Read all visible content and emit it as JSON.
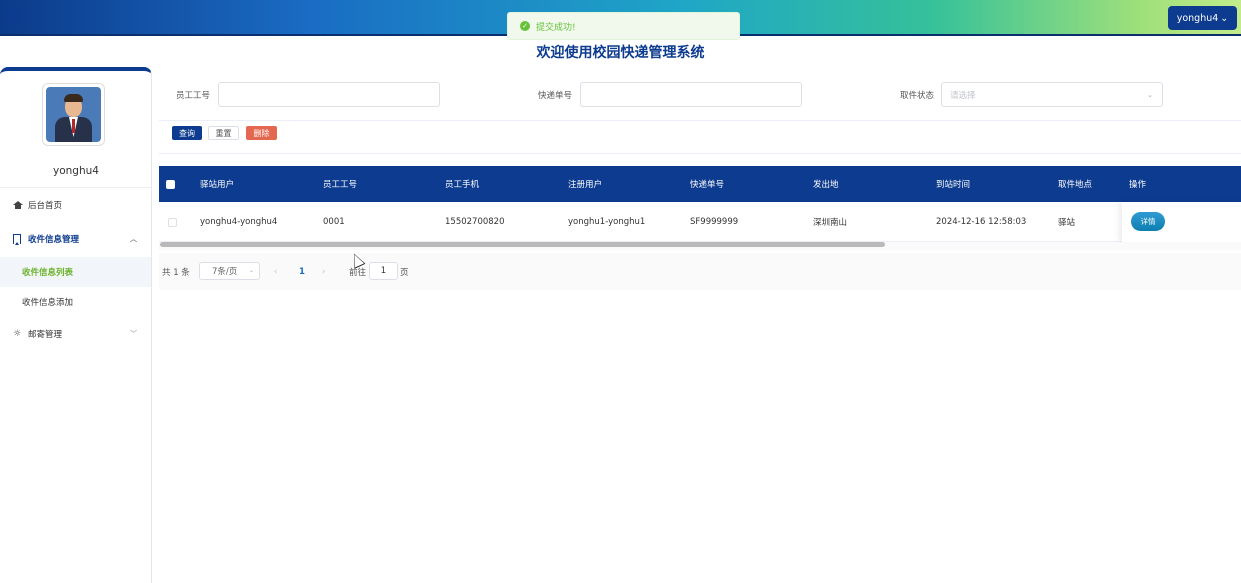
{
  "header": {
    "user_button": "yonghu4",
    "toast": "提交成功!",
    "title": "欢迎使用校园快递管理系统"
  },
  "sidebar": {
    "username": "yonghu4",
    "items": [
      {
        "label": "后台首页",
        "icon": "home-icon"
      },
      {
        "label": "收件信息管理",
        "icon": "bookmark-icon"
      },
      {
        "label": "收件信息列表"
      },
      {
        "label": "收件信息添加"
      },
      {
        "label": "邮寄管理",
        "icon": "gear-icon"
      }
    ]
  },
  "search": {
    "fields": [
      {
        "label": "员工工号",
        "value": "",
        "placeholder": ""
      },
      {
        "label": "快递单号",
        "value": "",
        "placeholder": ""
      },
      {
        "label": "取件状态",
        "value": "",
        "placeholder": "请选择"
      }
    ],
    "buttons": {
      "query": "查询",
      "reset": "重置",
      "delete": "删除"
    }
  },
  "table": {
    "columns": [
      "驿站用户",
      "员工工号",
      "员工手机",
      "注册用户",
      "快递单号",
      "发出地",
      "到站时间",
      "取件地点",
      "操作"
    ],
    "rows": [
      [
        "yonghu4-yonghu4",
        "0001",
        "15502700820",
        "yonghu1-yonghu1",
        "SF9999999",
        "深圳南山",
        "2024-12-16 12:58:03",
        "驿站"
      ]
    ],
    "detail_button": "详情"
  },
  "pagination": {
    "total": "共 1 条",
    "page_size": "7条/页",
    "current_page": "1",
    "goto_label": "前往",
    "goto_value": "1",
    "page_suffix": "页"
  },
  "colors": {
    "primary": "#0d3b8f",
    "success": "#67c23a",
    "danger": "#e4684f",
    "active_menu": "#6bb22a"
  }
}
